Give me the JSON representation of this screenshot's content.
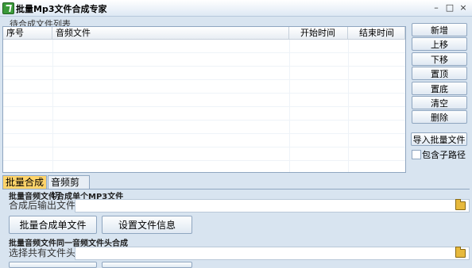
{
  "window": {
    "title": "批量Mp3文件合成专家",
    "min": "–",
    "max": "□",
    "close": "×"
  },
  "list_group": {
    "title": "待合成文件列表",
    "columns": [
      "序号",
      "音频文件",
      "开始时间",
      "结束时间"
    ]
  },
  "side_buttons": {
    "add": "新增",
    "up": "上移",
    "down": "下移",
    "top": "置顶",
    "bottom": "置底",
    "clear": "清空",
    "delete": "删除",
    "import": "导入批量文件",
    "include_subdirs": "包含子路径"
  },
  "tabs": {
    "merge": "批量合成",
    "cut": "音频剪切"
  },
  "section1": {
    "title": "批量音频文件合成单个MP3文件",
    "output_label": "合成后输出文件",
    "output_value": "",
    "merge_button": "批量合成单文件",
    "info_button": "设置文件信息"
  },
  "section2": {
    "title": "批量音频文件同一音频文件头合成",
    "header_label": "选择共有文件头",
    "header_value": ""
  }
}
